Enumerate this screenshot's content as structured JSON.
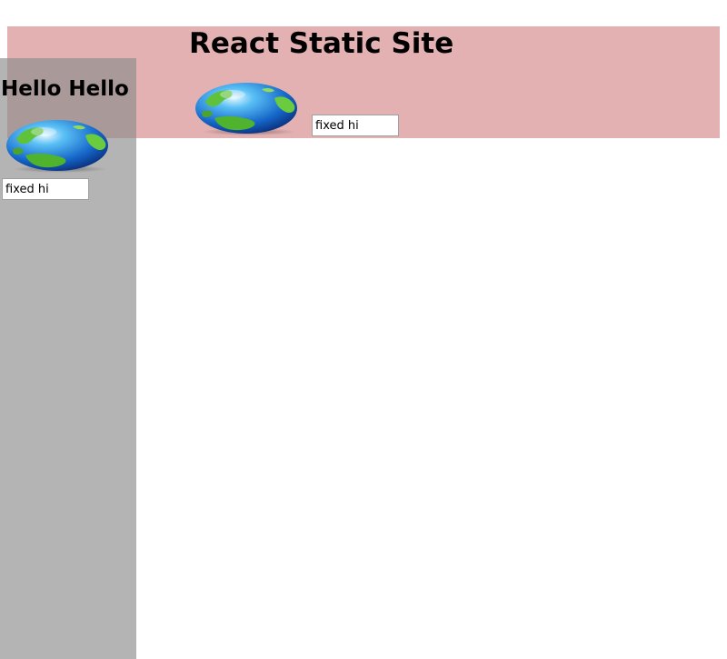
{
  "header": {
    "title": "React Static Site",
    "globe_icon": "globe-icon",
    "input_value": "fixed hi"
  },
  "sidebar": {
    "title": "Hello Hello",
    "globe_icon": "globe-icon",
    "input_value": "fixed hi"
  },
  "colors": {
    "header_band": "#e3b1b1",
    "sidebar_overlay": "#8c8c8c"
  }
}
